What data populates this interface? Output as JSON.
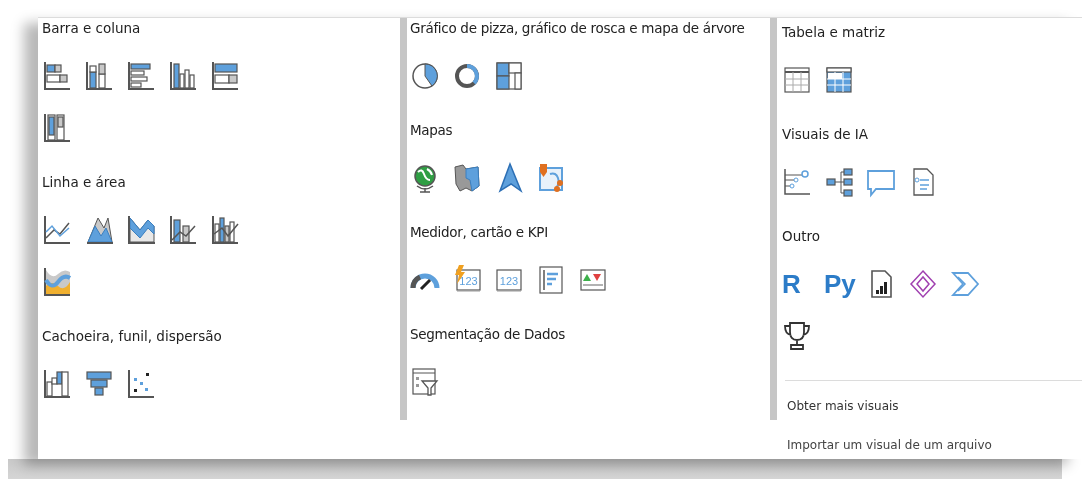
{
  "columns": [
    {
      "sections": [
        {
          "title": "Barra e coluna",
          "visuals": [
            {
              "kind": "hbarstacked"
            },
            {
              "kind": "colstacked"
            },
            {
              "kind": "hbarclustered"
            },
            {
              "kind": "colclustered"
            },
            {
              "kind": "hbar100"
            },
            {
              "kind": "col100"
            }
          ]
        },
        {
          "title": "Linha e área",
          "visuals": [
            {
              "kind": "line"
            },
            {
              "kind": "area"
            },
            {
              "kind": "stackedarea"
            },
            {
              "kind": "linecolstacked"
            },
            {
              "kind": "linecolclustered"
            },
            {
              "kind": "ribbon"
            }
          ]
        },
        {
          "title": "Cachoeira, funil, dispersão",
          "visuals": [
            {
              "kind": "waterfall"
            },
            {
              "kind": "funnel"
            },
            {
              "kind": "scatter"
            }
          ]
        }
      ]
    },
    {
      "sections": [
        {
          "title": "Gráfico de pizza, gráfico de rosca e mapa de árvore",
          "visuals": [
            {
              "kind": "pie"
            },
            {
              "kind": "donut"
            },
            {
              "kind": "treemap"
            }
          ]
        },
        {
          "title": "Mapas",
          "visuals": [
            {
              "kind": "globe"
            },
            {
              "kind": "filledmap"
            },
            {
              "kind": "arrowmap"
            },
            {
              "kind": "shapemap"
            }
          ]
        },
        {
          "title": "Medidor, cartão e KPI",
          "visuals": [
            {
              "kind": "gauge"
            },
            {
              "kind": "lightningcard",
              "label": "123"
            },
            {
              "kind": "card",
              "label": "123"
            },
            {
              "kind": "multirowcard"
            },
            {
              "kind": "kpi"
            }
          ]
        },
        {
          "title": "Segmentação de Dados",
          "visuals": [
            {
              "kind": "slicer"
            }
          ]
        }
      ]
    },
    {
      "sections": [
        {
          "title": "Tabela e matriz",
          "visuals": [
            {
              "kind": "table"
            },
            {
              "kind": "matrix"
            }
          ]
        },
        {
          "title": "Visuais de IA",
          "visuals": [
            {
              "kind": "influencers"
            },
            {
              "kind": "decomposition"
            },
            {
              "kind": "bubble"
            },
            {
              "kind": "narrative"
            }
          ]
        },
        {
          "title": "Outro",
          "visuals": [
            {
              "kind": "text",
              "label": "R"
            },
            {
              "kind": "text",
              "label": "Py"
            },
            {
              "kind": "paginated"
            },
            {
              "kind": "diamond"
            },
            {
              "kind": "chevron"
            },
            {
              "kind": "trophy"
            }
          ]
        }
      ],
      "links": [
        "Obter mais visuais",
        "Importar um visual de um arquivo"
      ]
    }
  ]
}
